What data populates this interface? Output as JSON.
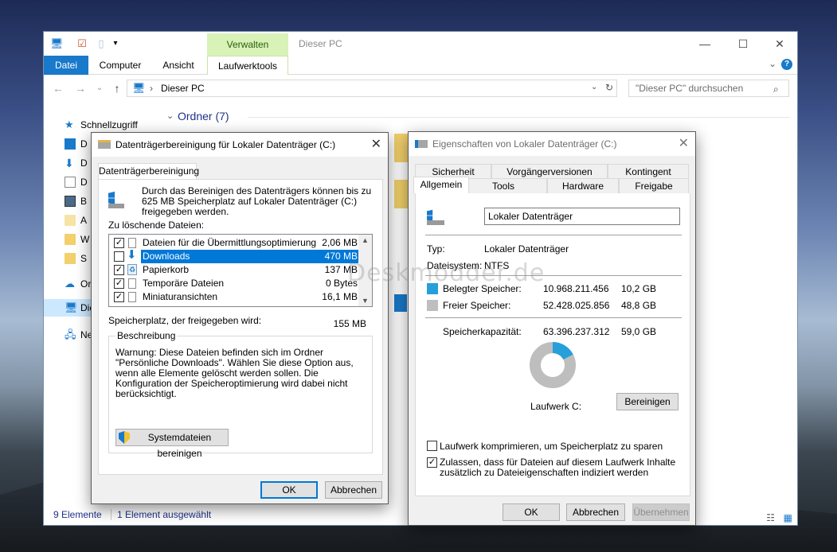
{
  "explorer": {
    "title": "Dieser PC",
    "context_tab": "Verwalten",
    "tabs": [
      "Datei",
      "Computer",
      "Ansicht",
      "Laufwerktools"
    ],
    "address": "Dieser PC",
    "search_placeholder": "\"Dieser PC\" durchsuchen",
    "sidebar": [
      "Schnellzugriff",
      "D",
      "D",
      "D",
      "B",
      "A",
      "W",
      "S",
      "Or",
      "Die",
      "Ne"
    ],
    "section_title": "Ordner (7)",
    "status_items": "9 Elemente",
    "status_selected": "1 Element ausgewählt"
  },
  "cleanup": {
    "title": "Datenträgerbereinigung für Lokaler Datenträger (C:)",
    "tab": "Datenträgerbereinigung",
    "intro": "Durch das Bereinigen des Datenträgers können bis zu 625 MB Speicherplatz auf Lokaler Datenträger (C:) freigegeben werden.",
    "list_label": "Zu löschende Dateien:",
    "files": [
      {
        "name": "Dateien für die Übermittlungsoptimierung",
        "size": "2,06 MB",
        "checked": true
      },
      {
        "name": "Downloads",
        "size": "470 MB",
        "checked": false
      },
      {
        "name": "Papierkorb",
        "size": "137 MB",
        "checked": true
      },
      {
        "name": "Temporäre Dateien",
        "size": "0 Bytes",
        "checked": true
      },
      {
        "name": "Miniaturansichten",
        "size": "16,1 MB",
        "checked": true
      }
    ],
    "freed_label": "Speicherplatz, der freigegeben wird:",
    "freed_value": "155 MB",
    "desc_title": "Beschreibung",
    "desc_text": "Warnung: Diese Dateien befinden sich im Ordner \"Persönliche Downloads\". Wählen Sie diese Option aus, wenn alle Elemente gelöscht werden sollen. Die Konfiguration der Speicheroptimierung wird dabei nicht berücksichtigt.",
    "sys_button": "Systemdateien bereinigen",
    "ok": "OK",
    "cancel": "Abbrechen"
  },
  "props": {
    "title": "Eigenschaften von Lokaler Datenträger (C:)",
    "tabs_row1": [
      "Sicherheit",
      "Vorgängerversionen",
      "Kontingent"
    ],
    "tabs_row2": [
      "Allgemein",
      "Tools",
      "Hardware",
      "Freigabe"
    ],
    "name_value": "Lokaler Datenträger",
    "type_label": "Typ:",
    "type_value": "Lokaler Datenträger",
    "fs_label": "Dateisystem:",
    "fs_value": "NTFS",
    "used_label": "Belegter Speicher:",
    "used_bytes": "10.968.211.456",
    "used_gb": "10,2 GB",
    "free_label": "Freier Speicher:",
    "free_bytes": "52.428.025.856",
    "free_gb": "48,8 GB",
    "cap_label": "Speicherkapazität:",
    "cap_bytes": "63.396.237.312",
    "cap_gb": "59,0 GB",
    "used_fraction": 0.173,
    "drive_label": "Laufwerk C:",
    "clean_button": "Bereinigen",
    "compress_label": "Laufwerk komprimieren, um Speicherplatz zu sparen",
    "compress_checked": false,
    "index_label": "Zulassen, dass für Dateien auf diesem Laufwerk Inhalte zusätzlich zu Dateieigenschaften indiziert werden",
    "index_checked": true,
    "ok": "OK",
    "cancel": "Abbrechen",
    "apply": "Übernehmen",
    "used_color": "#26a0da",
    "free_color": "#bebebe"
  },
  "watermark": "Deskmodder.de"
}
